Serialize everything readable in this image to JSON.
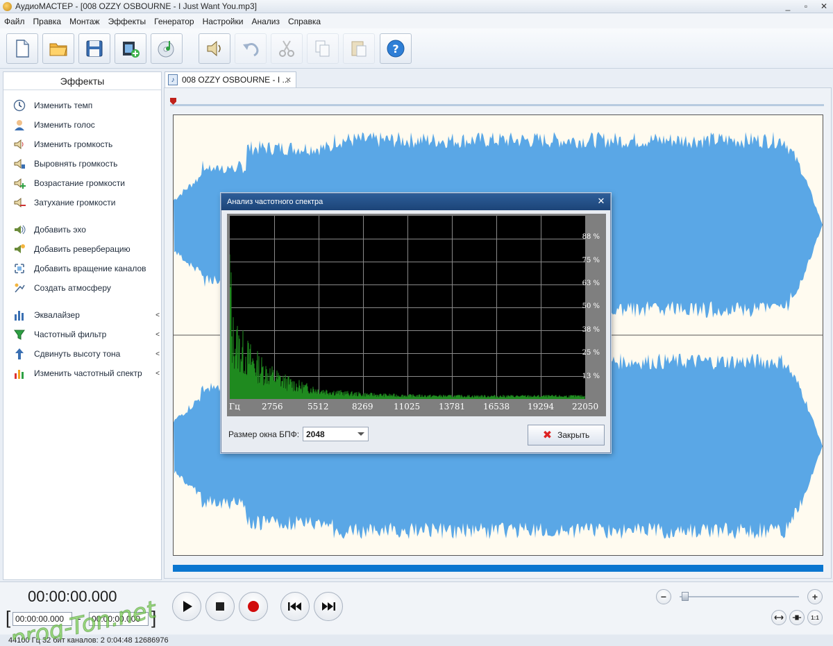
{
  "window": {
    "title": "АудиоМАСТЕР - [008 OZZY OSBOURNE - I Just Want You.mp3]",
    "controls": [
      "_",
      "▫",
      "✕"
    ]
  },
  "menu": [
    "Файл",
    "Правка",
    "Монтаж",
    "Эффекты",
    "Генератор",
    "Настройки",
    "Анализ",
    "Справка"
  ],
  "toolbar": {
    "icons": [
      "new-file-icon",
      "open-folder-icon",
      "save-icon",
      "add-video-icon",
      "cd-music-icon",
      "speaker-icon",
      "undo-icon",
      "cut-icon",
      "copy-icon",
      "paste-icon",
      "help-icon"
    ]
  },
  "effects": {
    "header": "Эффекты",
    "items": [
      {
        "label": "Изменить темп",
        "icon": "clock-icon",
        "group": 1
      },
      {
        "label": "Изменить голос",
        "icon": "user-voice-icon",
        "group": 1
      },
      {
        "label": "Изменить громкость",
        "icon": "volume-icon",
        "group": 1
      },
      {
        "label": "Выровнять громкость",
        "icon": "volume-level-icon",
        "group": 1
      },
      {
        "label": "Возрастание громкости",
        "icon": "fade-in-icon",
        "group": 1
      },
      {
        "label": "Затухание громкости",
        "icon": "fade-out-icon",
        "group": 1
      },
      {
        "label": "Добавить эхо",
        "icon": "echo-icon",
        "group": 2
      },
      {
        "label": "Добавить реверберацию",
        "icon": "reverb-icon",
        "group": 2
      },
      {
        "label": "Добавить вращение каналов",
        "icon": "rotate-channels-icon",
        "group": 2
      },
      {
        "label": "Создать атмосферу",
        "icon": "atmosphere-icon",
        "group": 2
      },
      {
        "label": "Эквалайзер",
        "icon": "equalizer-icon",
        "group": 3
      },
      {
        "label": "Частотный фильтр",
        "icon": "filter-icon",
        "group": 3
      },
      {
        "label": "Сдвинуть высоту тона",
        "icon": "pitch-shift-icon",
        "group": 3
      },
      {
        "label": "Изменить частотный спектр",
        "icon": "spectrum-icon",
        "group": 3
      }
    ],
    "arrow": "<"
  },
  "document_tab": {
    "label": "008 OZZY OSBOURNE - I ...",
    "close": "✕"
  },
  "colors": {
    "waveform": "#5aa7e6",
    "waveform_bg": "#fffbf0",
    "spectrum_line": "#1f8a1f",
    "accent": "#0a76d0"
  },
  "dialog": {
    "title": "Анализ частотного спектра",
    "close": "✕",
    "percent_labels": [
      "88 %",
      "75 %",
      "63 %",
      "50 %",
      "38 %",
      "25 %",
      "13 %"
    ],
    "freq_labels": [
      "Гц",
      "2756",
      "5512",
      "8269",
      "11025",
      "13781",
      "16538",
      "19294",
      "22050"
    ],
    "fft_label": "Размер окна БПФ:",
    "fft_value": "2048",
    "close_button": "Закрыть"
  },
  "transport": {
    "time_main": "00:00:00.000",
    "start": "00:00:00.000",
    "end": "00:00:00.000",
    "dash": "-",
    "bracket_left": "[",
    "bracket_right": "]",
    "zoom_out": "−",
    "zoom_in": "+",
    "zoom_level": 0.02
  },
  "status": {
    "text": "44100 Гц  32 бит  каналов: 2   0:04:48 12686976"
  },
  "watermark": {
    "text": "prog-Ton.net"
  }
}
